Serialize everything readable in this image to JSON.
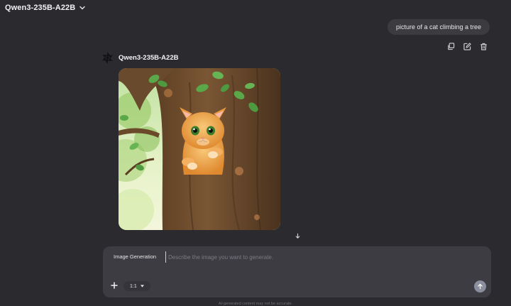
{
  "header": {
    "model_name": "Qwen3-235B-A22B",
    "dropdown_icon": "chevron-down-icon"
  },
  "user_message": {
    "text": "picture of a cat climbing a tree"
  },
  "message_actions": [
    {
      "icon": "copy-icon"
    },
    {
      "icon": "edit-icon"
    },
    {
      "icon": "trash-icon"
    }
  ],
  "assistant": {
    "name": "Qwen3-235B-A22B",
    "avatar_icon": "qwen-logo-icon"
  },
  "generated_image": {
    "subject": "cartoon kitten clinging to a tree trunk",
    "colors": {
      "fur": "#e8a548",
      "bark": "#6a4a2c",
      "leaves": "#5aa84a"
    }
  },
  "scroll_button": {
    "icon": "arrow-down-icon"
  },
  "composer": {
    "mode_label": "Image Generation",
    "placeholder": "Describe the image you want to generate.",
    "value": "",
    "add_icon": "plus-icon",
    "aspect_ratio": "1:1",
    "send_icon": "arrow-up-icon"
  },
  "footer": {
    "disclaimer": "AI-generated content may not be accurate."
  },
  "colors": {
    "background": "#2b2b2f",
    "composer": "#3c3c42",
    "send_button": "#8a8e9e"
  }
}
